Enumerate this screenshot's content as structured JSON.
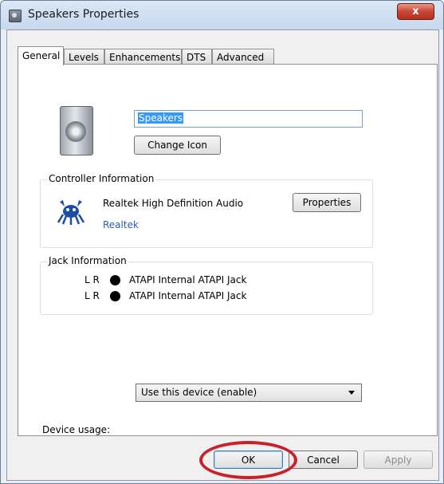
{
  "window": {
    "title": "Speakers Properties",
    "close_label": "x"
  },
  "tabs": [
    {
      "label": "General",
      "active": true
    },
    {
      "label": "Levels"
    },
    {
      "label": "Enhancements"
    },
    {
      "label": "DTS"
    },
    {
      "label": "Advanced"
    }
  ],
  "general": {
    "device_name": "Speakers",
    "change_icon_label": "Change Icon",
    "controller": {
      "group_label": "Controller Information",
      "name": "Realtek High Definition Audio",
      "vendor": "Realtek",
      "properties_label": "Properties"
    },
    "jack": {
      "group_label": "Jack Information",
      "items": [
        {
          "channels": "L R",
          "description": "ATAPI Internal ATAPI Jack"
        },
        {
          "channels": "L R",
          "description": "ATAPI Internal ATAPI Jack"
        }
      ]
    },
    "device_usage": {
      "label": "Device usage:",
      "selected": "Use this device (enable)"
    }
  },
  "footer": {
    "ok_label": "OK",
    "cancel_label": "Cancel",
    "apply_label": "Apply"
  },
  "colors": {
    "highlight": "#c9202a",
    "selection": "#3399ff"
  }
}
